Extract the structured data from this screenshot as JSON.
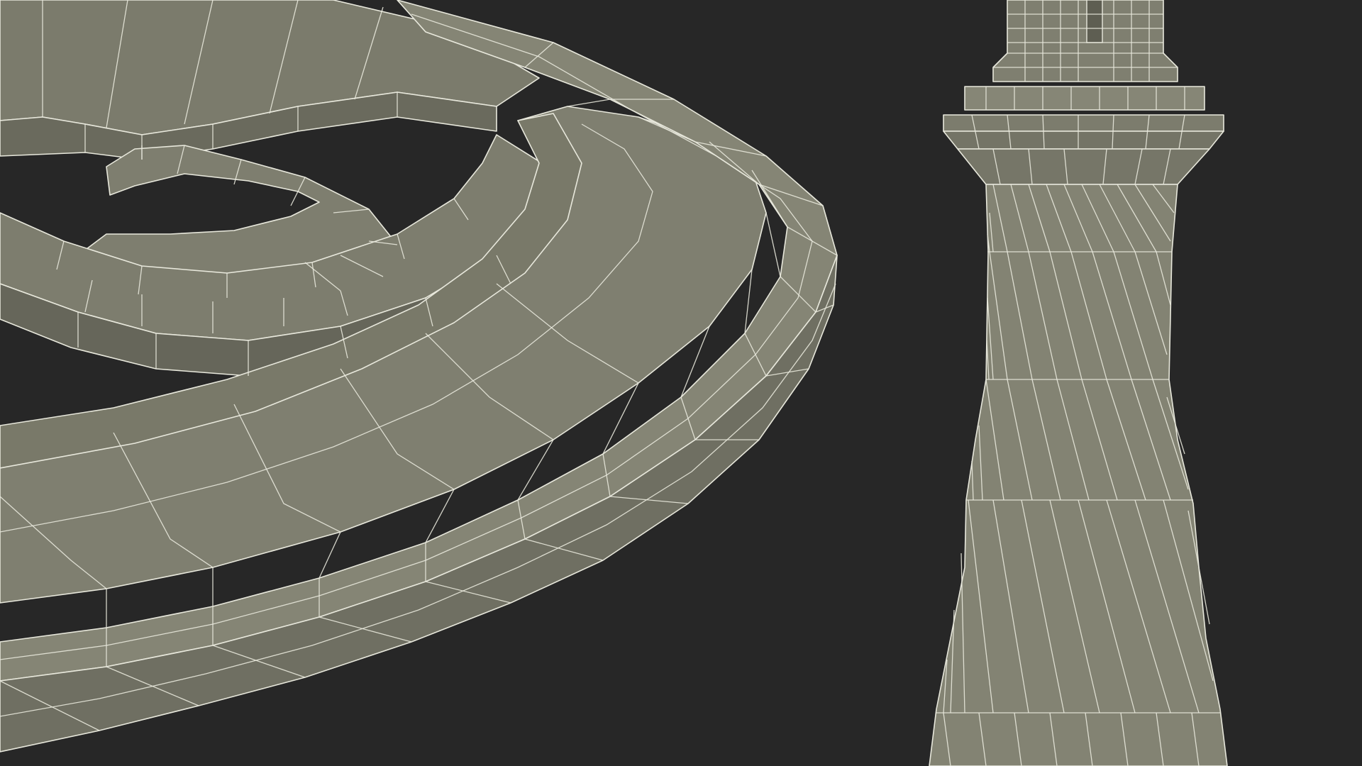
{
  "scene": {
    "background_color": "#272727",
    "mesh_fill_light": "#828272",
    "mesh_fill_mid": "#727264",
    "mesh_fill_dark": "#5f5f53",
    "wire_color": "#e8e8dc"
  },
  "objects": [
    {
      "name": "curved-wrought-iron-rail-mesh",
      "description_icon": "wireframe-rail"
    },
    {
      "name": "twisted-baluster-column-mesh",
      "description_icon": "wireframe-column"
    }
  ]
}
